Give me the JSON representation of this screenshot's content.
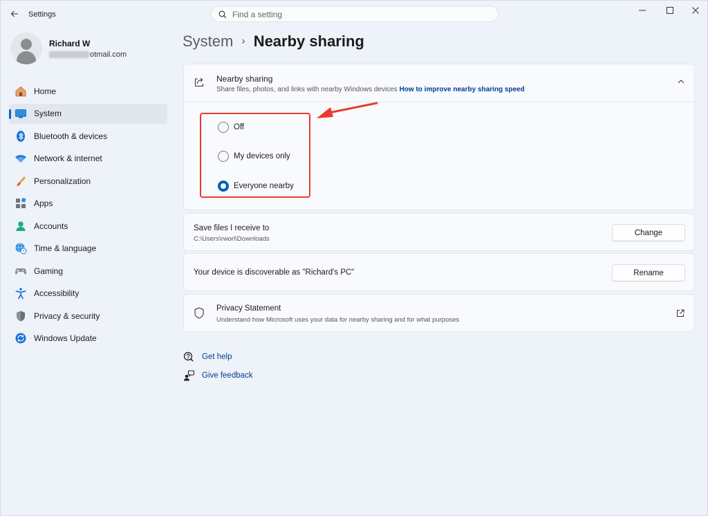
{
  "window": {
    "app_title": "Settings"
  },
  "search": {
    "placeholder": "Find a setting"
  },
  "profile": {
    "name": "Richard W",
    "email_suffix": "otmail.com"
  },
  "sidebar": {
    "items": [
      {
        "label": "Home",
        "icon": "home-icon"
      },
      {
        "label": "System",
        "icon": "system-icon",
        "active": true
      },
      {
        "label": "Bluetooth & devices",
        "icon": "bluetooth-icon"
      },
      {
        "label": "Network & internet",
        "icon": "wifi-icon"
      },
      {
        "label": "Personalization",
        "icon": "brush-icon"
      },
      {
        "label": "Apps",
        "icon": "apps-icon"
      },
      {
        "label": "Accounts",
        "icon": "accounts-icon"
      },
      {
        "label": "Time & language",
        "icon": "globe-clock-icon"
      },
      {
        "label": "Gaming",
        "icon": "gamepad-icon"
      },
      {
        "label": "Accessibility",
        "icon": "accessibility-icon"
      },
      {
        "label": "Privacy & security",
        "icon": "shield-icon"
      },
      {
        "label": "Windows Update",
        "icon": "update-icon"
      }
    ]
  },
  "breadcrumb": {
    "parent": "System",
    "separator": "›",
    "current": "Nearby sharing"
  },
  "nearby": {
    "title": "Nearby sharing",
    "subtitle": "Share files, photos, and links with nearby Windows devices",
    "link": "How to improve nearby sharing speed",
    "options": [
      {
        "label": "Off",
        "checked": false
      },
      {
        "label": "My devices only",
        "checked": false
      },
      {
        "label": "Everyone nearby",
        "checked": true
      }
    ]
  },
  "save_files": {
    "title": "Save files I receive to",
    "path": "C:\\Users\\rworl\\Downloads",
    "button": "Change"
  },
  "discoverable": {
    "title": "Your device is discoverable as \"Richard's PC\"",
    "button": "Rename"
  },
  "privacy": {
    "title": "Privacy Statement",
    "subtitle": "Understand how Microsoft uses your data for nearby sharing and for what purposes"
  },
  "help": {
    "get_help": "Get help",
    "give_feedback": "Give feedback"
  },
  "colors": {
    "accent": "#005fb8",
    "highlight_box": "#e93a2f",
    "link": "#003e92"
  }
}
